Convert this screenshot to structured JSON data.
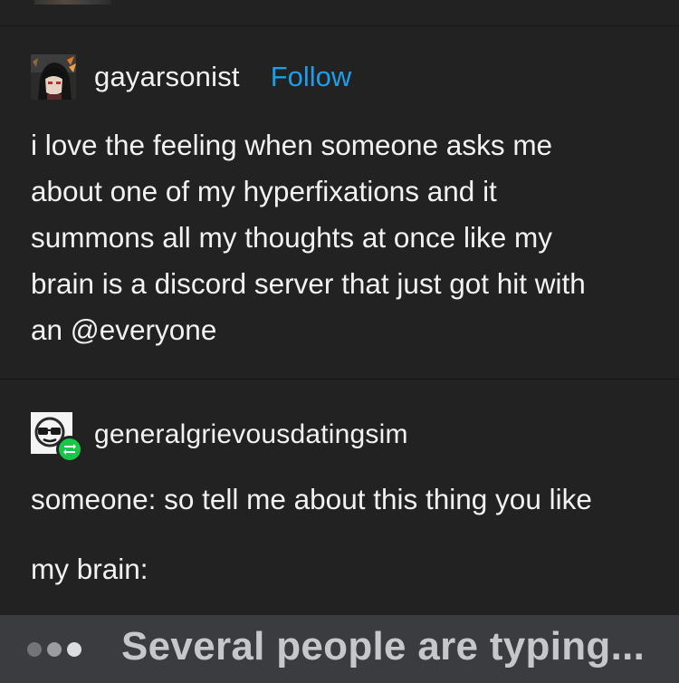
{
  "original_post": {
    "username": "gayarsonist",
    "follow_label": "Follow",
    "text": "i love the feeling when someone asks me\nabout one of my hyperfixations and it\nsummons all my thoughts at once like my\nbrain is a discord server that just got hit with\nan @everyone"
  },
  "reblog": {
    "username": "generalgrievousdatingsim",
    "line1": "someone: so tell me about this thing you like",
    "line2": "my brain:"
  },
  "discord_typing": {
    "text": "Several people are typing..."
  },
  "colors": {
    "background": "#222222",
    "follow_link": "#1e9de8",
    "reblog_badge": "#16c74a",
    "typing_bar": "#3a3c40"
  },
  "icons": {
    "reblog_badge": "retweet-arrows-icon",
    "typing_indicator": "typing-dots-icon"
  }
}
